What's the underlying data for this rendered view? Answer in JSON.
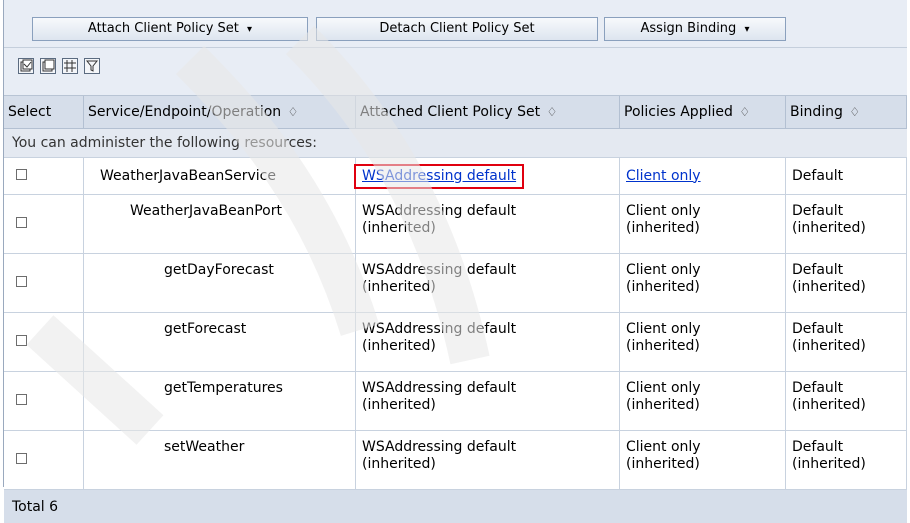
{
  "toolbar": {
    "attach_label": "Attach Client Policy Set",
    "detach_label": "Detach Client Policy Set",
    "assign_label": "Assign Binding",
    "dropdown_glyph": "▾"
  },
  "icon_buttons": [
    "select-all-icon",
    "deselect-all-icon",
    "show-filter-icon",
    "clear-filter-icon"
  ],
  "table": {
    "headers": {
      "select": "Select",
      "service": "Service/Endpoint/Operation",
      "attached": "Attached Client Policy Set",
      "policies": "Policies Applied",
      "binding": "Binding"
    },
    "sort_glyph": "♢",
    "message": "You can administer the following resources:",
    "rows": [
      {
        "name": "WeatherJavaBeanService",
        "attached": "WSAddressing default",
        "attached_suffix": "",
        "policies": "Client only",
        "policies_suffix": "",
        "binding": "Default",
        "binding_suffix": ""
      },
      {
        "name": "WeatherJavaBeanPort",
        "attached": "WSAddressing default",
        "attached_suffix": "(inherited)",
        "policies": "Client only",
        "policies_suffix": "(inherited)",
        "binding": "Default",
        "binding_suffix": "(inherited)"
      },
      {
        "name": "getDayForecast",
        "attached": "WSAddressing default",
        "attached_suffix": "(inherited)",
        "policies": "Client only",
        "policies_suffix": "(inherited)",
        "binding": "Default",
        "binding_suffix": "(inherited)"
      },
      {
        "name": "getForecast",
        "attached": "WSAddressing default",
        "attached_suffix": "(inherited)",
        "policies": "Client only",
        "policies_suffix": "(inherited)",
        "binding": "Default",
        "binding_suffix": "(inherited)"
      },
      {
        "name": "getTemperatures",
        "attached": "WSAddressing default",
        "attached_suffix": "(inherited)",
        "policies": "Client only",
        "policies_suffix": "(inherited)",
        "binding": "Default",
        "binding_suffix": "(inherited)"
      },
      {
        "name": "setWeather",
        "attached": "WSAddressing default",
        "attached_suffix": "(inherited)",
        "policies": "Client only",
        "policies_suffix": "(inherited)",
        "binding": "Default",
        "binding_suffix": "(inherited)"
      }
    ],
    "total": "Total 6"
  },
  "colors": {
    "link": "#0033cc",
    "highlight": "#e0000f",
    "header_bg": "#d6deea"
  }
}
